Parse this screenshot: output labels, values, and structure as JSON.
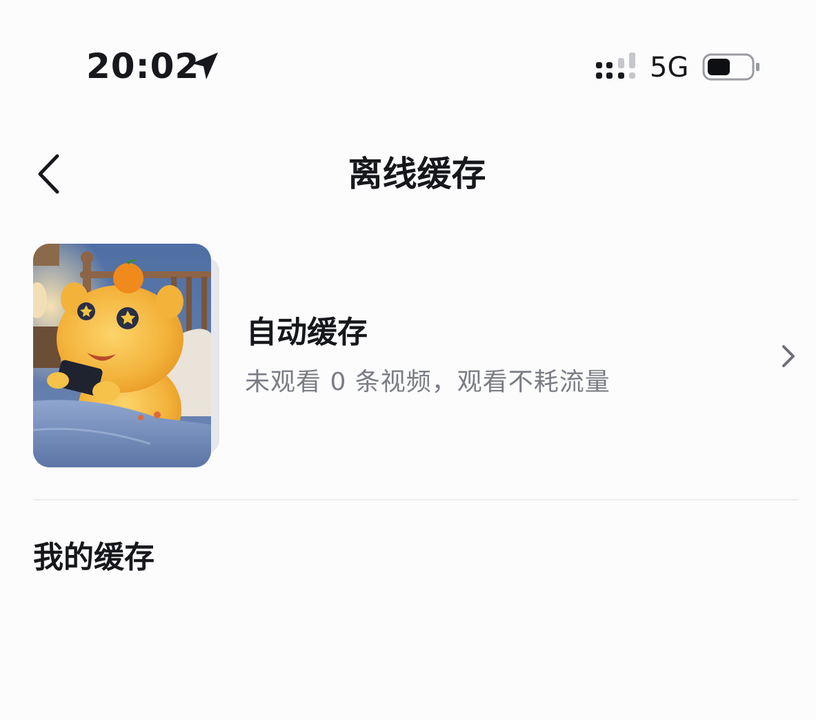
{
  "status_bar": {
    "time": "20:02",
    "network": "5G",
    "icons": [
      "location-arrow-icon",
      "signal-icon",
      "battery-icon"
    ]
  },
  "nav": {
    "title": "离线缓存",
    "back_icon": "chevron-left-icon"
  },
  "auto_cache": {
    "title": "自动缓存",
    "subtitle": "未观看 0 条视频，观看不耗流量",
    "chevron_icon": "chevron-right-icon",
    "thumbnail": "yellow-mascot-playing-phone-in-bed"
  },
  "my_cache": {
    "title": "我的缓存"
  },
  "colors": {
    "background": "#fcfcfd",
    "text_primary": "#17181c",
    "text_secondary": "#7b7d85",
    "divider": "#ececef",
    "mascot": "#f6b53a"
  }
}
